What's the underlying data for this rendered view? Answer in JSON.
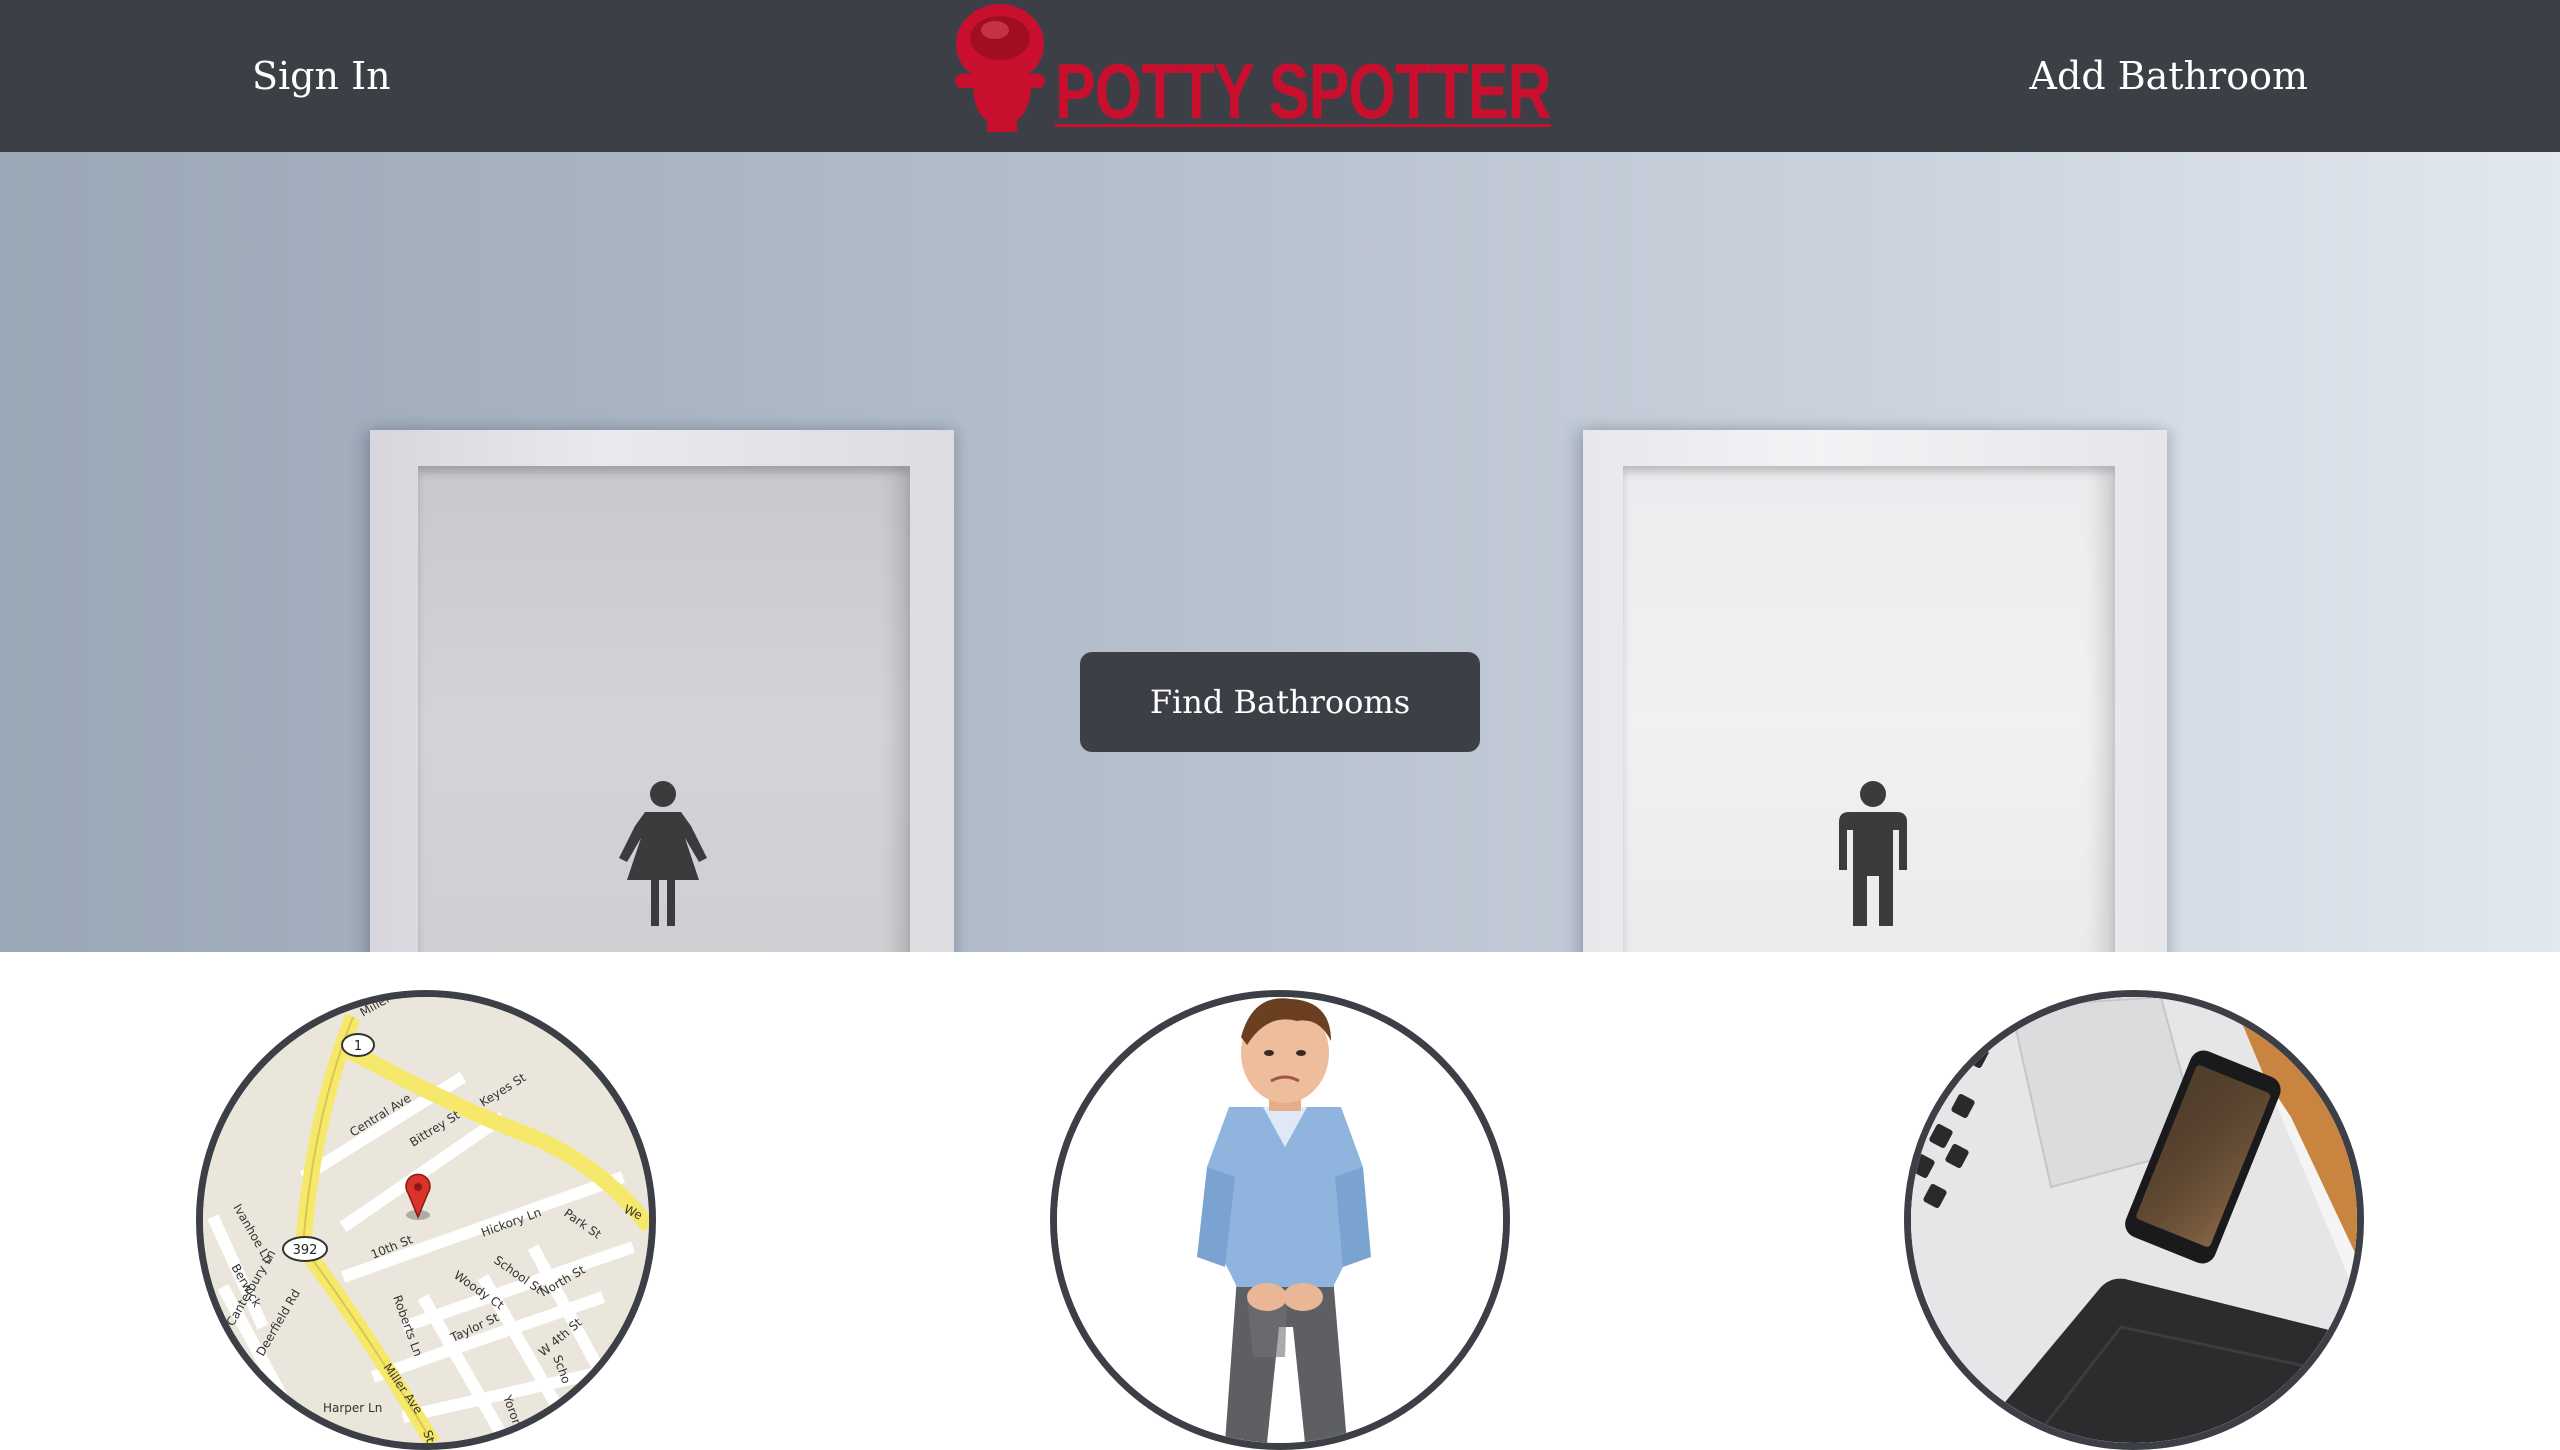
{
  "nav": {
    "sign_in": "Sign In",
    "add_bathroom": "Add Bathroom",
    "brand": "POTTY SPOTTER"
  },
  "hero": {
    "find_button": "Find Bathrooms"
  },
  "features": {
    "map": {
      "highway_1": "1",
      "highway_392": "392",
      "streets": [
        "Miller",
        "Central Ave",
        "Bittrey St",
        "Keyes St",
        "Ivanhoe Ln",
        "10th St",
        "Hickory Ln",
        "Park St",
        "School St",
        "Woody Ct",
        "North St",
        "Canterbury Ln",
        "Deerfield Rd",
        "Roberts Ln",
        "Taylor St",
        "W 4th St",
        "Miller Ave",
        "Harper Ln",
        "We",
        "Berwick",
        "Yoron",
        "Scho",
        "St"
      ]
    }
  },
  "colors": {
    "navbar": "#3d3f46",
    "brand_red": "#c8102e",
    "button": "#3d3f46",
    "map_road_major": "#f6e86a",
    "map_pin": "#d9342b"
  },
  "icons": [
    "toilet-logo-icon",
    "woman-restroom-icon",
    "man-restroom-icon",
    "map-pin-icon"
  ]
}
